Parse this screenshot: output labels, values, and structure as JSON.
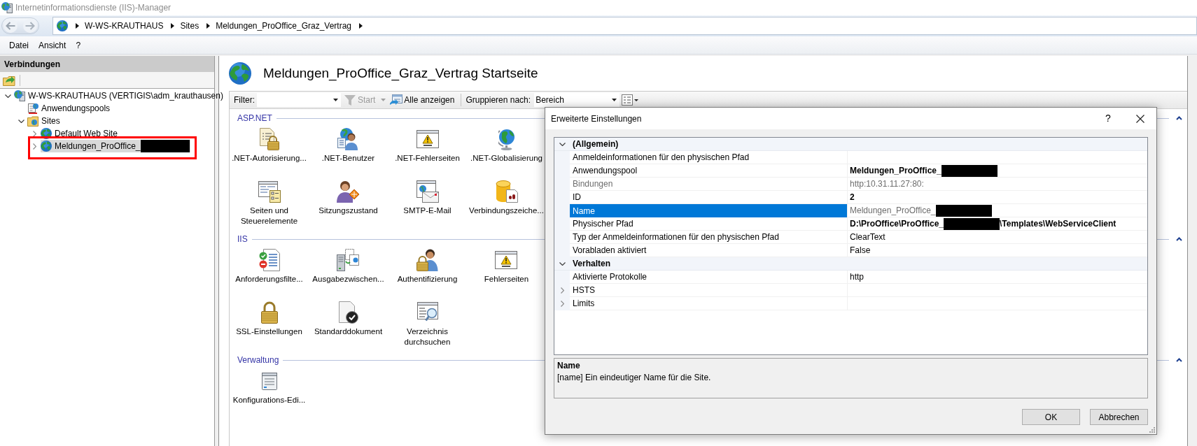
{
  "window": {
    "title": "Internetinformationsdienste (IIS)-Manager"
  },
  "address_bar": {
    "breadcrumbs": [
      "W-WS-KRAUTHAUS",
      "Sites",
      "Meldungen_ProOffice_Graz_Vertrag"
    ]
  },
  "menu": [
    "Datei",
    "Ansicht",
    "?"
  ],
  "connections": {
    "title": "Verbindungen",
    "tree": [
      {
        "label": "W-WS-KRAUTHAUS (VERTIGIS\\adm_krauthausen)",
        "expandable": true,
        "expanded": true,
        "selected": false,
        "redacted": false,
        "annotated": false,
        "children": [
          {
            "label": "Anwendungspools",
            "expandable": false,
            "selected": false,
            "redacted": false,
            "annotated": false
          },
          {
            "label": "Sites",
            "expandable": true,
            "expanded": true,
            "selected": false,
            "redacted": false,
            "annotated": false,
            "children": [
              {
                "label": "Default Web Site",
                "expandable": true,
                "expanded": false,
                "selected": false,
                "redacted": false,
                "annotated": false
              },
              {
                "label": "Meldungen_ProOffice_",
                "expandable": true,
                "expanded": false,
                "selected": true,
                "redacted": true,
                "annotated": true
              }
            ]
          }
        ]
      }
    ]
  },
  "main": {
    "title": "Meldungen_ProOffice_Graz_Vertrag Startseite",
    "toolbar": {
      "filter_label": "Filter:",
      "start": {
        "label": "Start",
        "disabled": true
      },
      "show_all": {
        "label": "Alle anzeigen",
        "disabled": false
      },
      "group_by_label": "Gruppieren nach:",
      "group_by_value": "Bereich"
    },
    "groups": [
      {
        "title": "ASP.NET",
        "expanded": true,
        "features": [
          {
            "label": ".NET-Autorisierung..."
          },
          {
            "label": ".NET-Benutzer"
          },
          {
            "label": ".NET-Fehlerseiten"
          },
          {
            "label": ".NET-Globalisierung"
          },
          {
            "label": "Seiten und Steuerelemente"
          },
          {
            "label": "Sitzungszustand"
          },
          {
            "label": "SMTP-E-Mail"
          },
          {
            "label": "Verbindungszeiche..."
          }
        ]
      },
      {
        "title": "IIS",
        "expanded": true,
        "features": [
          {
            "label": "Anforderungsfilte..."
          },
          {
            "label": "Ausgabezwischen..."
          },
          {
            "label": "Authentifizierung"
          },
          {
            "label": "Fehlerseiten"
          },
          {
            "label": "SSL-Einstellungen"
          },
          {
            "label": "Standarddokument"
          },
          {
            "label": "Verzeichnis durchsuchen"
          }
        ]
      },
      {
        "title": "Verwaltung",
        "expanded": true,
        "features": [
          {
            "label": "Konfigurations-Edi..."
          }
        ]
      }
    ]
  },
  "dialog": {
    "title": "Erweiterte Einstellungen",
    "help": "?",
    "categories": [
      {
        "name": "(Allgemein)",
        "expanded": true,
        "properties": [
          {
            "name": "Anmeldeinformationen für den physischen Pfad",
            "expandable": false,
            "selected": false,
            "disabled": false,
            "redacted": false
          },
          {
            "name": "Anwendungspool",
            "value": "Meldungen_ProOffice_",
            "bold": true,
            "greyed": false,
            "expandable": false,
            "selected": false,
            "disabled": false,
            "redacted": true
          },
          {
            "name": "Bindungen",
            "value": "http:10.31.11.27:80:",
            "bold": false,
            "greyed": true,
            "expandable": false,
            "selected": false,
            "disabled": true,
            "redacted": false
          },
          {
            "name": "ID",
            "value": "2",
            "bold": true,
            "greyed": false,
            "expandable": false,
            "selected": false,
            "disabled": false,
            "redacted": false
          },
          {
            "name": "Name",
            "value": "Meldungen_ProOffice_",
            "bold": false,
            "greyed": true,
            "expandable": false,
            "selected": true,
            "disabled": false,
            "redacted": true
          },
          {
            "name": "Physischer Pfad",
            "value": "D:\\ProOffice\\ProOffice_",
            "value_suffix": "\\Templates\\WebServiceClient",
            "bold": true,
            "greyed": false,
            "expandable": false,
            "selected": false,
            "disabled": false,
            "redacted": true
          },
          {
            "name": "Typ der Anmeldeinformationen für den physischen Pfad",
            "value": "ClearText",
            "bold": false,
            "greyed": false,
            "expandable": false,
            "selected": false,
            "disabled": false,
            "redacted": false
          },
          {
            "name": "Vorabladen aktiviert",
            "value": "False",
            "bold": false,
            "greyed": false,
            "expandable": false,
            "selected": false,
            "disabled": false,
            "redacted": false
          }
        ]
      },
      {
        "name": "Verhalten",
        "expanded": true,
        "properties": [
          {
            "name": "Aktivierte Protokolle",
            "value": "http",
            "bold": false,
            "greyed": false,
            "expandable": false,
            "selected": false,
            "disabled": false,
            "redacted": false
          },
          {
            "name": "HSTS",
            "expandable": true,
            "selected": false,
            "disabled": false,
            "redacted": false
          },
          {
            "name": "Limits",
            "expandable": true,
            "selected": false,
            "disabled": false,
            "redacted": false
          }
        ]
      }
    ],
    "description": {
      "title": "Name",
      "text": "[name] Ein eindeutiger Name für die Site."
    },
    "buttons": [
      "OK",
      "Abbrechen"
    ]
  }
}
